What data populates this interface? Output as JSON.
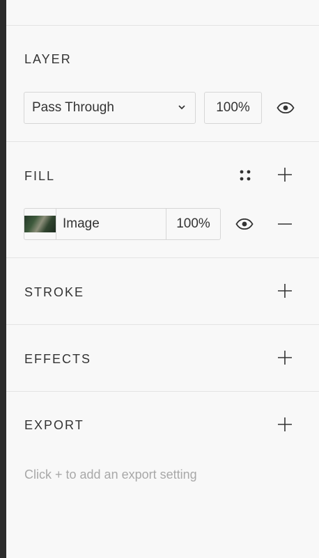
{
  "layer": {
    "title": "LAYER",
    "blend_mode": "Pass Through",
    "opacity": "100%",
    "visibility_icon": "eye-icon",
    "dropdown_icon": "chevron-down-icon"
  },
  "fill": {
    "title": "FILL",
    "style_icon": "dots-grid-icon",
    "add_icon": "plus-icon",
    "item": {
      "type": "Image",
      "opacity": "100%",
      "visibility_icon": "eye-icon",
      "remove_icon": "minus-icon"
    }
  },
  "stroke": {
    "title": "STROKE",
    "add_icon": "plus-icon"
  },
  "effects": {
    "title": "EFFECTS",
    "add_icon": "plus-icon"
  },
  "export": {
    "title": "EXPORT",
    "add_icon": "plus-icon",
    "hint": "Click + to add an export setting"
  },
  "colors": {
    "background": "#f8f8f8",
    "text": "#333333",
    "muted_text": "#a8a8a8",
    "divider": "#e3e3e3",
    "left_strip": "#2c2c2c"
  }
}
